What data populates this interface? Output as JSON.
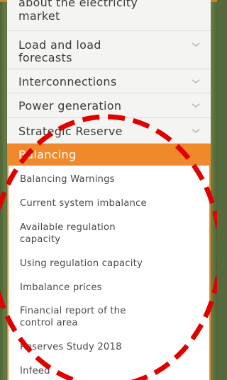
{
  "colors": {
    "accent": "#f0892b",
    "annotation": "#e00000",
    "menu_background": "#f4f4f3",
    "outer_background": "#556a3c"
  },
  "menu": {
    "items": [
      {
        "label_line1": "about the electricity",
        "label_line2": "market",
        "has_chevron": false
      },
      {
        "label_line1": "Load and load",
        "label_line2": "forecasts",
        "icon": "chevron-down-icon"
      },
      {
        "label": "Interconnections",
        "icon": "chevron-down-icon"
      },
      {
        "label": "Power generation",
        "icon": "chevron-down-icon"
      },
      {
        "label": "Strategic Reserve",
        "icon": "chevron-down-icon"
      }
    ],
    "active": {
      "label": "Balancing"
    },
    "subitems": [
      {
        "label": "Balancing Warnings"
      },
      {
        "label": "Current system imbalance"
      },
      {
        "label_line1": "Available regulation",
        "label_line2": "capacity"
      },
      {
        "label": "Using regulation capacity"
      },
      {
        "label": "Imbalance prices"
      },
      {
        "label_line1": "Financial report of the",
        "label_line2": "control area"
      },
      {
        "label": "Reserves Study 2018"
      },
      {
        "label": "Infeed"
      }
    ]
  }
}
